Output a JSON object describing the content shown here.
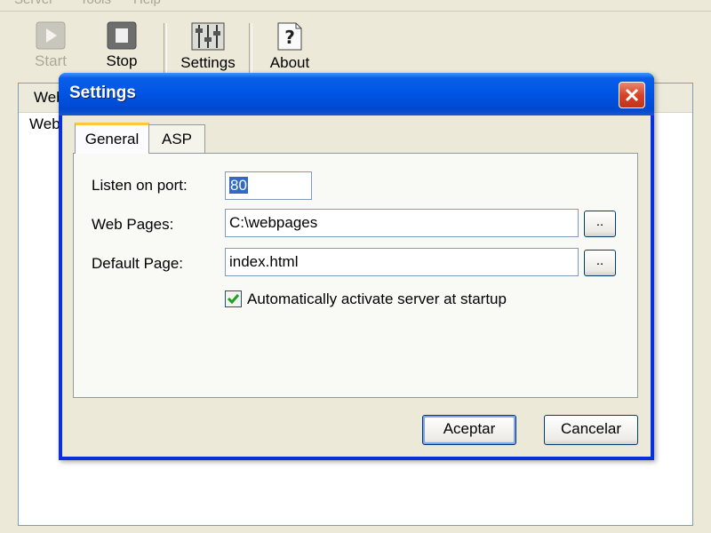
{
  "menubar": {
    "items": [
      "Server",
      "Tools",
      "Help"
    ]
  },
  "toolbar": {
    "start_label": "Start",
    "stop_label": "Stop",
    "settings_label": "Settings",
    "about_label": "About"
  },
  "main_list": {
    "header": "Web",
    "rows": [
      "Web"
    ]
  },
  "dialog": {
    "title": "Settings",
    "tabs": [
      {
        "label": "General",
        "selected": true
      },
      {
        "label": "ASP",
        "selected": false
      }
    ],
    "fields": {
      "port_label": "Listen on port:",
      "port_value": "80",
      "webpages_label": "Web Pages:",
      "webpages_value": "C:\\webpages",
      "default_label": "Default Page:",
      "default_value": "index.html",
      "browse_label": ".."
    },
    "autostart": {
      "label": "Automatically activate server at startup",
      "checked": true
    },
    "ok_label": "Aceptar",
    "cancel_label": "Cancelar"
  },
  "colors": {
    "titlebar": "#0054e3",
    "close_button": "#d8422a",
    "selection": "#316ac5",
    "check_mark": "#21a121",
    "active_tab_accent": "#ffc83c"
  }
}
